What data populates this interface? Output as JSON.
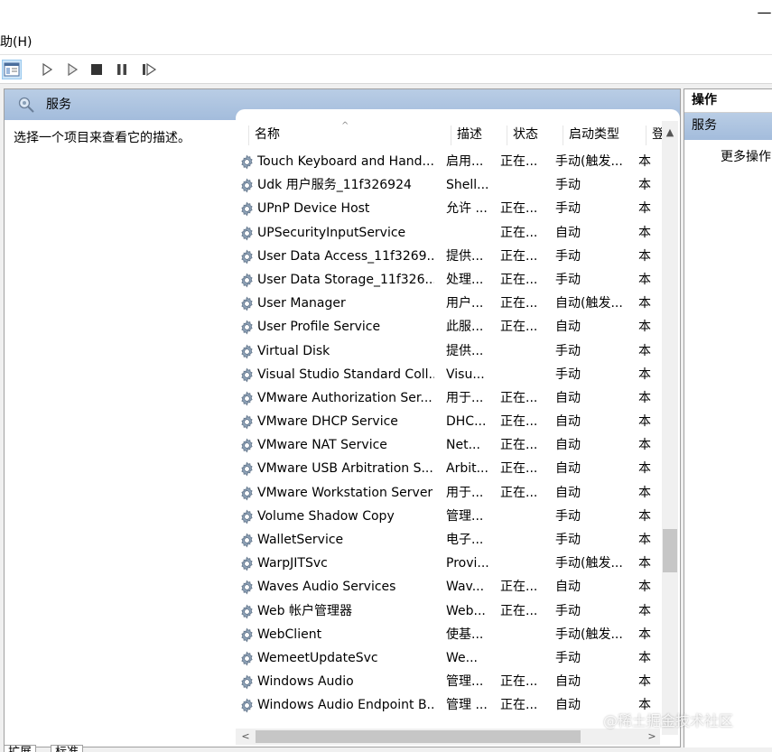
{
  "menubar": {
    "help_label": "助(H)"
  },
  "pane": {
    "title": "服务",
    "description_hint": "选择一个项目来查看它的描述。"
  },
  "columns": {
    "name": "名称",
    "description": "描述",
    "status": "状态",
    "startup_type": "启动类型",
    "logon_as": "登"
  },
  "services": [
    {
      "name": "Touch Keyboard and Hand...",
      "description": "启用...",
      "status": "正在...",
      "startup": "手动(触发...",
      "logon": "本"
    },
    {
      "name": "Udk 用户服务_11f326924",
      "description": "Shell...",
      "status": "",
      "startup": "手动",
      "logon": "本"
    },
    {
      "name": "UPnP Device Host",
      "description": "允许 ...",
      "status": "正在...",
      "startup": "手动",
      "logon": "本"
    },
    {
      "name": "UPSecurityInputService",
      "description": "",
      "status": "正在...",
      "startup": "自动",
      "logon": "本"
    },
    {
      "name": "User Data Access_11f3269...",
      "description": "提供...",
      "status": "正在...",
      "startup": "手动",
      "logon": "本"
    },
    {
      "name": "User Data Storage_11f326...",
      "description": "处理...",
      "status": "正在...",
      "startup": "手动",
      "logon": "本"
    },
    {
      "name": "User Manager",
      "description": "用户...",
      "status": "正在...",
      "startup": "自动(触发...",
      "logon": "本"
    },
    {
      "name": "User Profile Service",
      "description": "此服...",
      "status": "正在...",
      "startup": "自动",
      "logon": "本"
    },
    {
      "name": "Virtual Disk",
      "description": "提供...",
      "status": "",
      "startup": "手动",
      "logon": "本"
    },
    {
      "name": "Visual Studio Standard Coll...",
      "description": "Visu...",
      "status": "",
      "startup": "手动",
      "logon": "本"
    },
    {
      "name": "VMware Authorization Ser...",
      "description": "用于...",
      "status": "正在...",
      "startup": "自动",
      "logon": "本"
    },
    {
      "name": "VMware DHCP Service",
      "description": "DHC...",
      "status": "正在...",
      "startup": "自动",
      "logon": "本"
    },
    {
      "name": "VMware NAT Service",
      "description": "Net...",
      "status": "正在...",
      "startup": "自动",
      "logon": "本"
    },
    {
      "name": "VMware USB Arbitration S...",
      "description": "Arbit...",
      "status": "正在...",
      "startup": "自动",
      "logon": "本"
    },
    {
      "name": "VMware Workstation Server",
      "description": "用于...",
      "status": "正在...",
      "startup": "自动",
      "logon": "本"
    },
    {
      "name": "Volume Shadow Copy",
      "description": "管理...",
      "status": "",
      "startup": "手动",
      "logon": "本"
    },
    {
      "name": "WalletService",
      "description": "电子...",
      "status": "",
      "startup": "手动",
      "logon": "本"
    },
    {
      "name": "WarpJITSvc",
      "description": "Provi...",
      "status": "",
      "startup": "手动(触发...",
      "logon": "本"
    },
    {
      "name": "Waves Audio Services",
      "description": "Wav...",
      "status": "正在...",
      "startup": "自动",
      "logon": "本"
    },
    {
      "name": "Web 帐户管理器",
      "description": "Web...",
      "status": "正在...",
      "startup": "手动",
      "logon": "本"
    },
    {
      "name": "WebClient",
      "description": "使基...",
      "status": "",
      "startup": "手动(触发...",
      "logon": "本"
    },
    {
      "name": "WemeetUpdateSvc",
      "description": "We...",
      "status": "",
      "startup": "手动",
      "logon": "本"
    },
    {
      "name": "Windows Audio",
      "description": "管理...",
      "status": "正在...",
      "startup": "自动",
      "logon": "本"
    },
    {
      "name": "Windows Audio Endpoint B...",
      "description": "管理 ...",
      "status": "正在...",
      "startup": "自动",
      "logon": "本"
    }
  ],
  "actions": {
    "title": "操作",
    "group": "服务",
    "more": "更多操作"
  },
  "tabs": {
    "extended": "扩展",
    "standard": "标准"
  },
  "watermark": "@稀土掘金技术社区",
  "colors": {
    "header_gradient_top": "#b9cde5",
    "header_gradient_bottom": "#a3bcdc",
    "toolbar_active": "#cce4f7",
    "workspace_bg": "#f0f0f0"
  },
  "icons": {
    "service": "gear-icon",
    "pane": "magnifier-gear-icon"
  }
}
